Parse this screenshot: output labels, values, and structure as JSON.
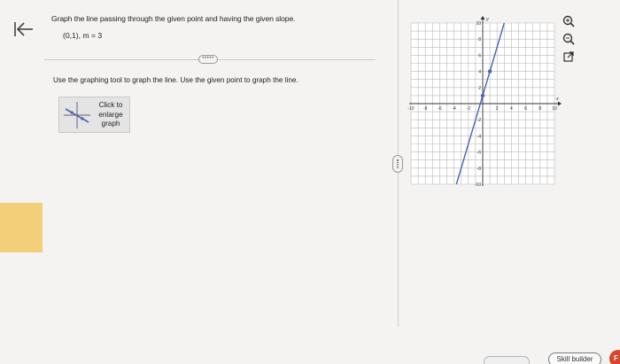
{
  "question": {
    "prompt": "Graph the line passing through the given point and having the given slope.",
    "given": "(0,1), m = 3",
    "dots": "•••••",
    "instruction": "Use the graphing tool to graph the line. Use the given point to graph the line."
  },
  "enlarge": {
    "lines": [
      "Click to",
      "enlarge",
      "graph"
    ]
  },
  "graph": {
    "x_axis_label": "x",
    "y_axis_label": "y",
    "xlim": [
      -10,
      10
    ],
    "ylim": [
      -10,
      10
    ],
    "x_ticks": [
      {
        "value": -10,
        "label": "-10"
      },
      {
        "value": -8,
        "label": "-8"
      },
      {
        "value": -6,
        "label": "-6"
      },
      {
        "value": -4,
        "label": "-4"
      },
      {
        "value": -2,
        "label": "-2"
      },
      {
        "value": 2,
        "label": "2"
      },
      {
        "value": 4,
        "label": "4"
      },
      {
        "value": 6,
        "label": "6"
      },
      {
        "value": 8,
        "label": "8"
      },
      {
        "value": 10,
        "label": "10"
      }
    ],
    "y_ticks": [
      {
        "value": 10,
        "label": "10"
      },
      {
        "value": 8,
        "label": "8"
      },
      {
        "value": 6,
        "label": "6"
      },
      {
        "value": 4,
        "label": "4"
      },
      {
        "value": 2,
        "label": "2"
      },
      {
        "value": -2,
        "label": "-2"
      },
      {
        "value": -4,
        "label": "-4"
      },
      {
        "value": -6,
        "label": "-6"
      },
      {
        "value": -8,
        "label": "-8"
      },
      {
        "value": -10,
        "label": "-10"
      }
    ],
    "line": {
      "slope": 3,
      "intercept": 1,
      "color": "#4b63b3"
    },
    "points": [
      {
        "x": 0,
        "y": 1
      },
      {
        "x": 1,
        "y": 4
      }
    ]
  },
  "tools": [
    {
      "name": "zoom-in-icon",
      "label": "zoom in"
    },
    {
      "name": "zoom-out-icon",
      "label": "zoom out"
    },
    {
      "name": "open-external-icon",
      "label": "open"
    }
  ],
  "footer": {
    "skill_builder": "Skill builder",
    "badge": "F"
  },
  "colors": {
    "accent": "#4b63b3",
    "highlight": "#f3cf7a",
    "badge": "#d9442b"
  }
}
